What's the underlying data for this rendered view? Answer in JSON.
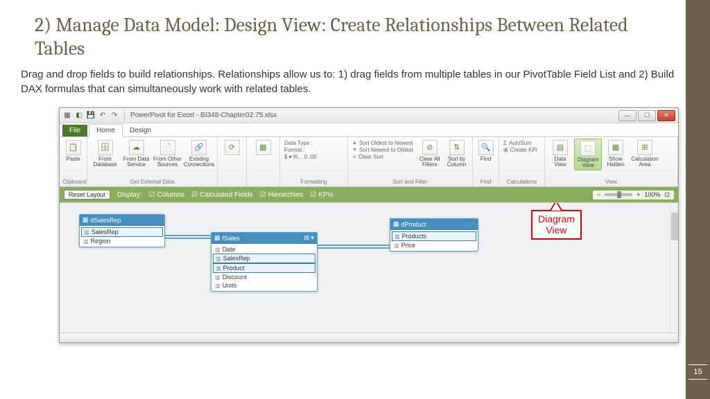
{
  "slide": {
    "title": "2) Manage Data Model: Design View: Create Relationships Between Related Tables",
    "body": "Drag and drop fields to build relationships. Relationships allow us to: 1) drag fields from multiple tables in our PivotTable Field List and 2) Build DAX formulas that can simultaneously work with related tables.",
    "page_number": "15"
  },
  "window": {
    "title": "PowerPivot for Excel - BI348-Chapter02.75.xlsx",
    "tabs": {
      "file": "File",
      "home": "Home",
      "design": "Design"
    }
  },
  "ribbon": {
    "groups": {
      "clipboard": {
        "label": "Clipboard",
        "paste": "Paste"
      },
      "external": {
        "label": "Get External Data",
        "db": "From Database",
        "svc": "From Data Service",
        "other": "From Other Sources",
        "conn": "Existing Connections"
      },
      "refresh": "Refresh",
      "pivot": "PivotTable",
      "formatting": {
        "label": "Formatting",
        "datatype": "Data Type :",
        "format": "Format :",
        "symbols": "$ ▾ % , .0 .00"
      },
      "sort": {
        "label": "Sort and Filter",
        "r1": "Sort Oldest to Newest",
        "r2": "Sort Newest to Oldest",
        "r3": "Clear Sort",
        "clearall": "Clear All Filters",
        "sortby": "Sort by Column"
      },
      "find": {
        "label": "Find",
        "btn": "Find"
      },
      "calc": {
        "label": "Calculations",
        "r1": "AutoSum",
        "r2": "Create KPI"
      },
      "view": {
        "label": "View",
        "data": "Data View",
        "diagram": "Diagram View",
        "hidden": "Show Hidden",
        "area": "Calculation Area"
      }
    }
  },
  "optbar": {
    "reset": "Reset Layout",
    "display": "Display:",
    "c1": "Columns",
    "c2": "Calculated Fields",
    "c3": "Hierarchies",
    "c4": "KPIs",
    "zoom": "100%"
  },
  "tables": {
    "t1": {
      "name": "dSalesRep",
      "f1": "SalesRep",
      "f2": "Region"
    },
    "t2": {
      "name": "fSales",
      "f1": "Date",
      "f2": "SalesRep",
      "f3": "Product",
      "f4": "Discount",
      "f5": "Units"
    },
    "t3": {
      "name": "dProduct",
      "f1": "Products",
      "f2": "Price"
    }
  },
  "callout": {
    "l1": "Diagram",
    "l2": "View"
  }
}
